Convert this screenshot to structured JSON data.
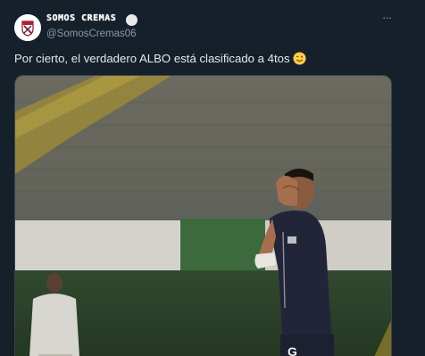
{
  "tweet": {
    "author": {
      "display_name": "SOMOS CREMAS",
      "handle": "@SomosCremas06",
      "avatar_icon": "club-crest-icon",
      "badge_icon": "verified-badge-icon"
    },
    "more_icon": "more-options-icon",
    "more_label": "···",
    "text": "Por cierto, el verdadero ALBO está clasificado a 4tos",
    "emoji_icon": "winking-face-emoji-icon",
    "media": {
      "description_icon": "football-player-photo",
      "jersey_letter": "G"
    }
  },
  "colors": {
    "background": "#15202b",
    "text_primary": "#e7e9ea",
    "text_secondary": "#8b98a5",
    "border": "#38444d"
  }
}
